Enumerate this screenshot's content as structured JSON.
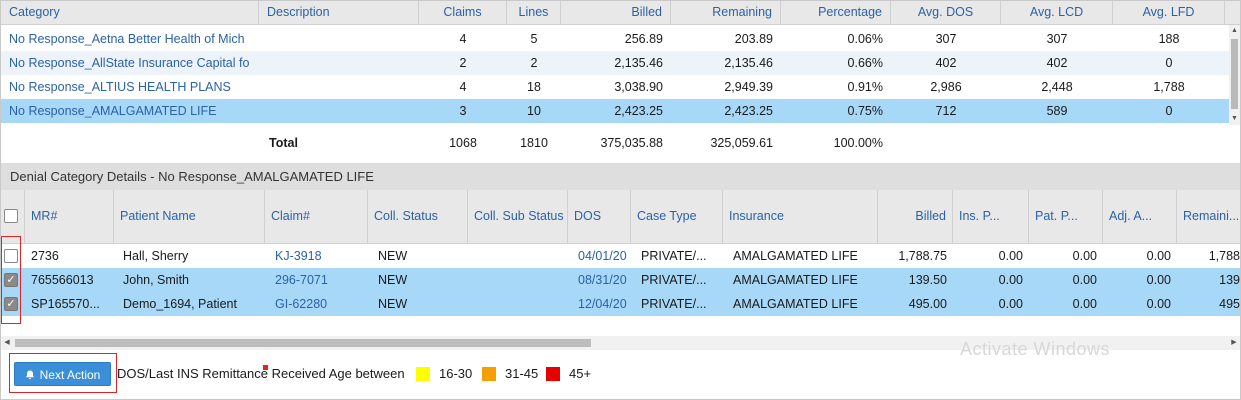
{
  "top_table": {
    "headers": {
      "category": "Category",
      "description": "Description",
      "claims": "Claims",
      "lines": "Lines",
      "billed": "Billed",
      "remaining": "Remaining",
      "percentage": "Percentage",
      "avg_dos": "Avg. DOS",
      "avg_lcd": "Avg. LCD",
      "avg_lfd": "Avg. LFD"
    },
    "rows": [
      {
        "category": "No Response_Aetna Better Health of Mich",
        "description": "",
        "claims": "4",
        "lines": "5",
        "billed": "256.89",
        "remaining": "203.89",
        "percentage": "0.06%",
        "avg_dos": "307",
        "avg_lcd": "307",
        "avg_lfd": "188"
      },
      {
        "category": "No Response_AllState Insurance Capital fo",
        "description": "",
        "claims": "2",
        "lines": "2",
        "billed": "2,135.46",
        "remaining": "2,135.46",
        "percentage": "0.66%",
        "avg_dos": "402",
        "avg_lcd": "402",
        "avg_lfd": "0"
      },
      {
        "category": "No Response_ALTIUS HEALTH PLANS",
        "description": "",
        "claims": "4",
        "lines": "18",
        "billed": "3,038.90",
        "remaining": "2,949.39",
        "percentage": "0.91%",
        "avg_dos": "2,986",
        "avg_lcd": "2,448",
        "avg_lfd": "1,788"
      },
      {
        "category": "No Response_AMALGAMATED LIFE",
        "description": "",
        "claims": "3",
        "lines": "10",
        "billed": "2,423.25",
        "remaining": "2,423.25",
        "percentage": "0.75%",
        "avg_dos": "712",
        "avg_lcd": "589",
        "avg_lfd": "0"
      }
    ],
    "total": {
      "label": "Total",
      "claims": "1068",
      "lines": "1810",
      "billed": "375,035.88",
      "remaining": "325,059.61",
      "percentage": "100.00%"
    }
  },
  "detail": {
    "title": "Denial Category Details - No Response_AMALGAMATED LIFE",
    "headers": {
      "mr": "MR#",
      "patient_name": "Patient Name",
      "claim": "Claim#",
      "coll_status": "Coll. Status",
      "coll_sub_status": "Coll. Sub Status",
      "dos": "DOS",
      "case_type": "Case Type",
      "insurance": "Insurance",
      "billed": "Billed",
      "ins_p": "Ins. P...",
      "pat_p": "Pat. P...",
      "adj_a": "Adj. A...",
      "remaining": "Remaini..."
    },
    "rows": [
      {
        "checked": false,
        "mr": "2736",
        "patient_name": "Hall, Sherry",
        "claim": "KJ-3918",
        "coll_status": "NEW",
        "coll_sub_status": "",
        "dos": "04/01/20",
        "case_type": "PRIVATE/...",
        "insurance": "AMALGAMATED LIFE",
        "billed": "1,788.75",
        "ins_p": "0.00",
        "pat_p": "0.00",
        "adj_a": "0.00",
        "remaining": "1,788"
      },
      {
        "checked": true,
        "mr": "765566013",
        "patient_name": "John, Smith",
        "claim": "296-7071",
        "coll_status": "NEW",
        "coll_sub_status": "",
        "dos": "08/31/20",
        "case_type": "PRIVATE/...",
        "insurance": "AMALGAMATED LIFE",
        "billed": "139.50",
        "ins_p": "0.00",
        "pat_p": "0.00",
        "adj_a": "0.00",
        "remaining": "139"
      },
      {
        "checked": true,
        "mr": "SP165570...",
        "patient_name": "Demo_1694, Patient",
        "claim": "GI-62280",
        "coll_status": "NEW",
        "coll_sub_status": "",
        "dos": "12/04/20",
        "case_type": "PRIVATE/...",
        "insurance": "AMALGAMATED LIFE",
        "billed": "495.00",
        "ins_p": "0.00",
        "pat_p": "0.00",
        "adj_a": "0.00",
        "remaining": "495"
      }
    ]
  },
  "footer": {
    "next_action_label": "Next Action",
    "legend_text": "DOS/Last INS Remittance Received Age between",
    "legend": [
      {
        "label": "16-30",
        "color": "#ffff00"
      },
      {
        "label": "31-45",
        "color": "#f5a000"
      },
      {
        "label": "45+",
        "color": "#e60000"
      }
    ],
    "watermark": "Activate Windows"
  },
  "colors": {
    "link": "#2a62a8",
    "selected_row": "#a8d8f8",
    "header_bg": "#e8e8e8",
    "button": "#3b8fd8",
    "highlight_box": "#e02424"
  }
}
